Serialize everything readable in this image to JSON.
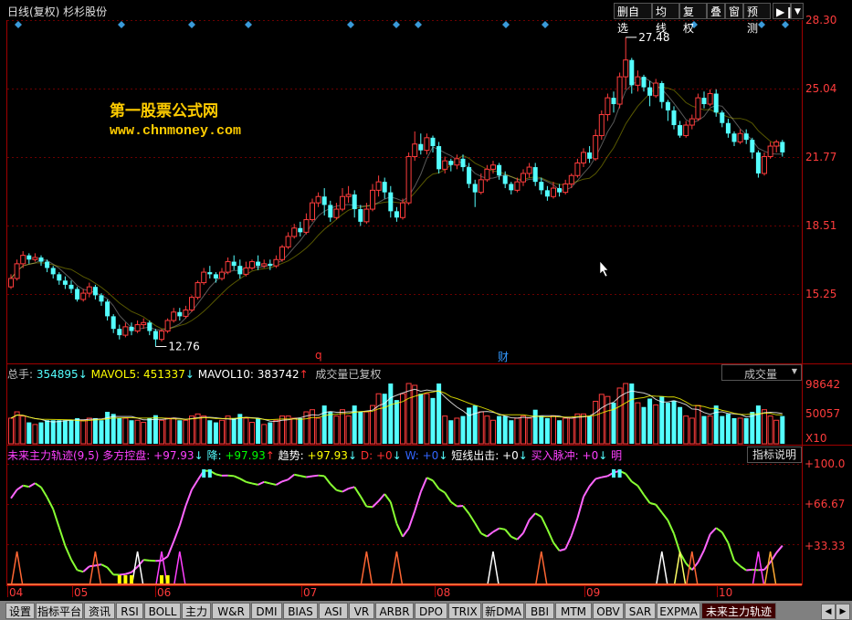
{
  "header": {
    "title": "日线(复权)  杉杉股份",
    "buttons": [
      "删自选",
      "均线",
      "复权",
      "叠",
      "窗",
      "预测"
    ]
  },
  "logo_text": {
    "line1": "第一股票公式网",
    "line2": "www.chnmoney.com"
  },
  "markers": {
    "q": "q",
    "cai": "财"
  },
  "volume_panel": {
    "label_total": "总手:",
    "total": "354895",
    "label_mavol5": "MAVOL5:",
    "mavol5": "451337",
    "label_mavol10": "MAVOL10:",
    "mavol10": "383742",
    "note": "成交量已复权",
    "selector": "成交量",
    "axis_labels": [
      "98642",
      "50057",
      "X10"
    ]
  },
  "indicator_panel": {
    "name": "未来主力轨迹(9,5)",
    "items": [
      {
        "label": "多方控盘:",
        "value": "+97.93"
      },
      {
        "label": "降:",
        "value": "+97.93"
      },
      {
        "label": "趋势:",
        "value": "+97.93"
      },
      {
        "label": "D:",
        "value": "+0"
      },
      {
        "label": "W:",
        "value": "+0"
      },
      {
        "label": "短线出击:",
        "value": "+0"
      },
      {
        "label": "买入脉冲:",
        "value": "+0"
      },
      {
        "label": "明",
        "value": ""
      }
    ],
    "help_button": "指标说明",
    "axis_labels": [
      "+100.0",
      "+66.67",
      "+33.33"
    ]
  },
  "x_axis_labels": [
    "04",
    "05",
    "06",
    "07",
    "08",
    "09",
    "10"
  ],
  "bottom_tabs": [
    "设置",
    "指标平台",
    "资讯",
    "RSI",
    "BOLL",
    "主力",
    "W&R",
    "DMI",
    "BIAS",
    "ASI",
    "VR",
    "ARBR",
    "DPO",
    "TRIX",
    "新DMA",
    "BBI",
    "MTM",
    "OBV",
    "SAR",
    "EXPMA",
    "未来主力轨迹"
  ],
  "colors": {
    "up": "#ff3c3c",
    "down": "#54ffff",
    "ma": "#ffffff",
    "axis": "#a00000"
  },
  "chart_data": {
    "type": "candlestick",
    "ylim": [
      12.0,
      28.3
    ],
    "y_ticks": [
      "28.30",
      "25.04",
      "21.77",
      "18.51",
      "15.25"
    ],
    "annotations": [
      {
        "label": "27.48",
        "value": 27.48,
        "kind": "high"
      },
      {
        "label": "12.76",
        "value": 12.76,
        "kind": "low"
      }
    ],
    "candles": [
      [
        15.6,
        16.0,
        15.5,
        16.2
      ],
      [
        16.0,
        16.7,
        15.9,
        16.9
      ],
      [
        16.7,
        17.1,
        16.5,
        17.3
      ],
      [
        17.1,
        16.9,
        16.7,
        17.2
      ],
      [
        16.9,
        17.0,
        16.8,
        17.2
      ],
      [
        17.0,
        16.8,
        16.6,
        17.1
      ],
      [
        16.8,
        16.5,
        16.3,
        16.9
      ],
      [
        16.5,
        16.2,
        16.0,
        16.6
      ],
      [
        16.2,
        15.9,
        15.7,
        16.3
      ],
      [
        15.9,
        15.7,
        15.5,
        16.1
      ],
      [
        15.7,
        15.5,
        15.3,
        15.9
      ],
      [
        15.5,
        15.0,
        14.9,
        15.6
      ],
      [
        15.0,
        15.3,
        14.9,
        15.5
      ],
      [
        15.3,
        15.6,
        15.1,
        15.8
      ],
      [
        15.6,
        15.2,
        15.0,
        15.7
      ],
      [
        15.2,
        14.9,
        14.7,
        15.3
      ],
      [
        14.9,
        14.2,
        14.0,
        15.0
      ],
      [
        14.2,
        13.6,
        13.4,
        14.3
      ],
      [
        13.6,
        13.3,
        13.1,
        13.8
      ],
      [
        13.3,
        13.7,
        13.2,
        13.9
      ],
      [
        13.7,
        13.5,
        13.3,
        13.9
      ],
      [
        13.5,
        13.8,
        13.4,
        14.0
      ],
      [
        13.8,
        13.9,
        13.6,
        14.1
      ],
      [
        13.9,
        13.5,
        13.3,
        14.0
      ],
      [
        13.5,
        13.1,
        12.76,
        13.6
      ],
      [
        13.1,
        13.5,
        13.0,
        13.6
      ],
      [
        13.5,
        14.0,
        13.4,
        14.1
      ],
      [
        14.0,
        14.4,
        13.9,
        14.6
      ],
      [
        14.4,
        14.2,
        14.0,
        14.6
      ],
      [
        14.2,
        14.5,
        14.1,
        14.7
      ],
      [
        14.5,
        15.1,
        14.4,
        15.2
      ],
      [
        15.1,
        15.8,
        15.0,
        15.9
      ],
      [
        15.8,
        16.3,
        15.7,
        16.5
      ],
      [
        16.3,
        16.2,
        16.0,
        16.6
      ],
      [
        16.2,
        16.0,
        15.8,
        16.3
      ],
      [
        16.0,
        16.3,
        15.9,
        16.5
      ],
      [
        16.3,
        16.8,
        16.2,
        17.0
      ],
      [
        16.8,
        16.6,
        16.4,
        17.1
      ],
      [
        16.6,
        16.2,
        16.0,
        16.9
      ],
      [
        16.2,
        16.5,
        16.1,
        16.8
      ],
      [
        16.5,
        16.8,
        16.4,
        16.9
      ],
      [
        16.8,
        16.6,
        16.4,
        17.1
      ],
      [
        16.6,
        16.7,
        16.5,
        16.9
      ],
      [
        16.7,
        16.6,
        16.4,
        16.9
      ],
      [
        16.6,
        16.9,
        16.5,
        17.1
      ],
      [
        16.9,
        17.5,
        16.8,
        17.6
      ],
      [
        17.5,
        18.0,
        17.4,
        18.2
      ],
      [
        18.0,
        18.4,
        17.9,
        18.6
      ],
      [
        18.4,
        18.2,
        18.0,
        18.7
      ],
      [
        18.2,
        18.8,
        18.1,
        19.1
      ],
      [
        18.8,
        19.6,
        18.7,
        19.8
      ],
      [
        19.6,
        19.9,
        19.4,
        20.1
      ],
      [
        19.9,
        19.5,
        19.0,
        20.3
      ],
      [
        19.5,
        18.9,
        18.7,
        19.7
      ],
      [
        18.9,
        19.3,
        18.8,
        19.6
      ],
      [
        19.3,
        19.9,
        19.2,
        20.3
      ],
      [
        19.9,
        20.0,
        19.6,
        20.4
      ],
      [
        20.0,
        19.3,
        18.9,
        20.2
      ],
      [
        19.3,
        18.7,
        18.5,
        19.5
      ],
      [
        18.7,
        19.3,
        18.6,
        19.6
      ],
      [
        19.3,
        20.2,
        19.2,
        20.5
      ],
      [
        20.2,
        20.6,
        19.9,
        20.9
      ],
      [
        20.6,
        20.1,
        19.8,
        20.8
      ],
      [
        20.1,
        19.2,
        18.9,
        20.4
      ],
      [
        19.2,
        18.9,
        18.7,
        19.4
      ],
      [
        18.9,
        19.6,
        18.8,
        19.8
      ],
      [
        19.6,
        21.8,
        19.5,
        22.0
      ],
      [
        21.8,
        22.4,
        21.6,
        23.0
      ],
      [
        22.4,
        22.1,
        21.9,
        22.9
      ],
      [
        22.1,
        22.7,
        21.9,
        22.9
      ],
      [
        22.7,
        22.3,
        22.0,
        22.8
      ],
      [
        22.3,
        21.2,
        21.0,
        22.5
      ],
      [
        21.2,
        21.6,
        21.0,
        21.8
      ],
      [
        21.6,
        21.4,
        21.1,
        21.7
      ],
      [
        21.4,
        21.7,
        21.2,
        21.9
      ],
      [
        21.7,
        21.3,
        21.1,
        21.9
      ],
      [
        21.3,
        20.5,
        20.3,
        21.5
      ],
      [
        20.5,
        20.1,
        19.4,
        20.7
      ],
      [
        20.1,
        20.7,
        20.0,
        21.0
      ],
      [
        20.7,
        21.2,
        20.6,
        21.4
      ],
      [
        21.2,
        21.4,
        21.0,
        21.6
      ],
      [
        21.4,
        20.9,
        20.7,
        21.5
      ],
      [
        20.9,
        20.5,
        20.3,
        21.1
      ],
      [
        20.5,
        20.2,
        20.0,
        20.6
      ],
      [
        20.2,
        20.6,
        20.1,
        20.8
      ],
      [
        20.6,
        21.0,
        20.4,
        21.2
      ],
      [
        21.0,
        21.3,
        20.8,
        21.5
      ],
      [
        21.3,
        20.6,
        20.4,
        21.5
      ],
      [
        20.6,
        20.2,
        20.0,
        20.8
      ],
      [
        20.2,
        19.9,
        19.7,
        20.4
      ],
      [
        19.9,
        20.3,
        19.8,
        20.6
      ],
      [
        20.3,
        20.1,
        19.9,
        20.5
      ],
      [
        20.1,
        20.5,
        20.0,
        20.7
      ],
      [
        20.5,
        20.9,
        20.3,
        21.0
      ],
      [
        20.9,
        21.5,
        20.8,
        21.7
      ],
      [
        21.5,
        22.0,
        21.3,
        22.2
      ],
      [
        22.0,
        21.7,
        21.5,
        22.3
      ],
      [
        21.7,
        22.8,
        21.6,
        23.1
      ],
      [
        22.8,
        23.8,
        22.6,
        24.0
      ],
      [
        23.8,
        24.6,
        23.5,
        24.8
      ],
      [
        24.6,
        24.3,
        23.9,
        24.9
      ],
      [
        24.3,
        25.6,
        24.1,
        25.8
      ],
      [
        25.6,
        26.4,
        25.0,
        27.48
      ],
      [
        26.4,
        25.2,
        24.8,
        26.5
      ],
      [
        25.2,
        25.6,
        24.9,
        25.9
      ],
      [
        25.6,
        25.1,
        24.9,
        25.7
      ],
      [
        25.1,
        24.7,
        24.2,
        25.4
      ],
      [
        24.7,
        25.3,
        24.6,
        25.5
      ],
      [
        25.3,
        24.4,
        24.1,
        25.4
      ],
      [
        24.4,
        24.0,
        23.5,
        24.5
      ],
      [
        24.0,
        23.3,
        23.1,
        24.2
      ],
      [
        23.3,
        22.8,
        22.7,
        23.5
      ],
      [
        22.8,
        23.3,
        22.7,
        23.5
      ],
      [
        23.3,
        23.6,
        23.1,
        23.8
      ],
      [
        23.6,
        24.6,
        23.5,
        24.8
      ],
      [
        24.6,
        24.3,
        24.1,
        24.9
      ],
      [
        24.3,
        24.8,
        24.2,
        25.0
      ],
      [
        24.8,
        23.9,
        23.7,
        25.0
      ],
      [
        23.9,
        23.4,
        23.2,
        24.0
      ],
      [
        23.4,
        22.9,
        22.7,
        23.6
      ],
      [
        22.9,
        22.5,
        22.3,
        23.0
      ],
      [
        22.5,
        22.9,
        22.4,
        23.1
      ],
      [
        22.9,
        22.6,
        22.4,
        23.1
      ],
      [
        22.6,
        22.0,
        21.7,
        22.7
      ],
      [
        22.0,
        21.0,
        20.8,
        22.1
      ],
      [
        21.0,
        21.8,
        20.9,
        22.0
      ],
      [
        21.8,
        22.3,
        21.7,
        22.5
      ],
      [
        22.3,
        22.5,
        22.0,
        22.6
      ],
      [
        22.5,
        22.0,
        21.8,
        22.6
      ]
    ],
    "volume_ticks": [
      "98642",
      "50057"
    ]
  }
}
